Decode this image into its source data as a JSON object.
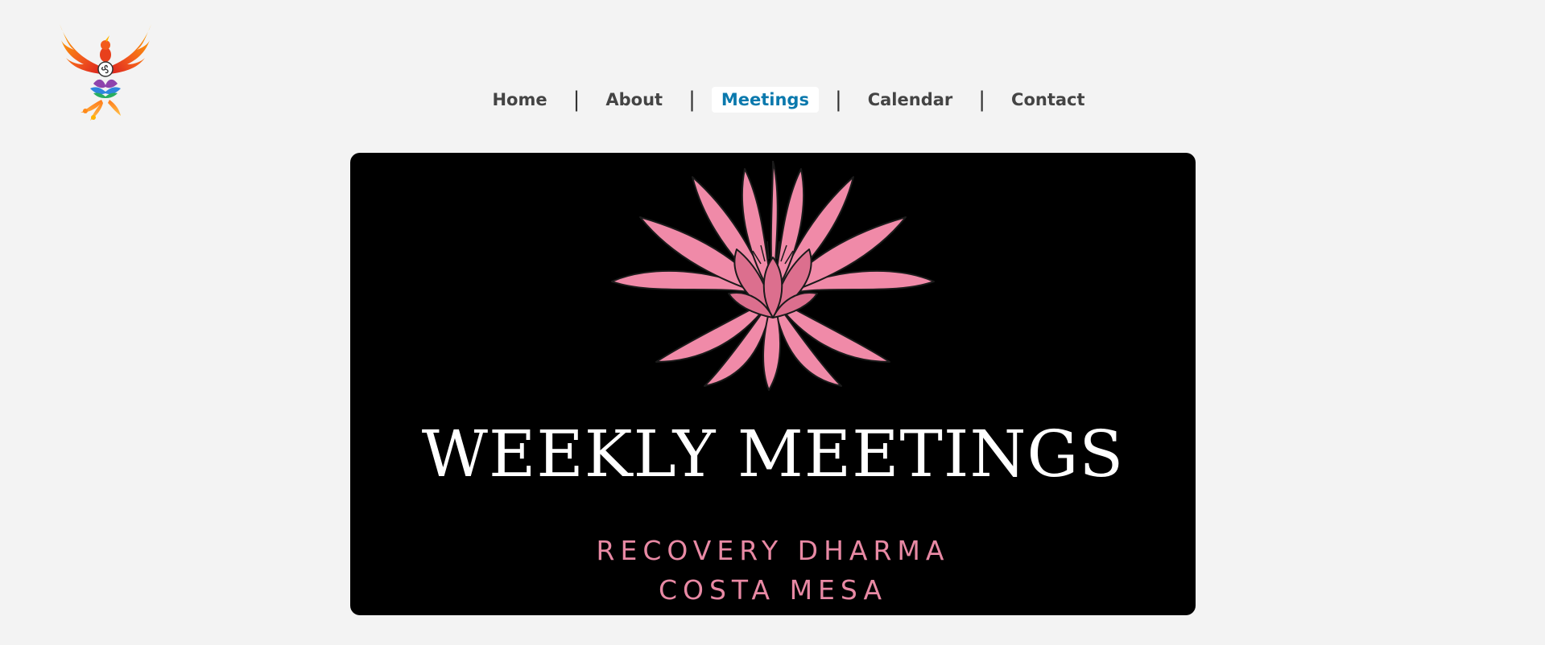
{
  "brand": {
    "logo_icon": "phoenix-lotus-logo"
  },
  "nav": {
    "items": [
      {
        "label": "Home",
        "active": false
      },
      {
        "label": "About",
        "active": false
      },
      {
        "label": "Meetings",
        "active": true
      },
      {
        "label": "Calendar",
        "active": false
      },
      {
        "label": "Contact",
        "active": false
      }
    ],
    "separator": "|",
    "active_color": "#0b79ad",
    "text_color": "#444444"
  },
  "hero": {
    "title": "WEEKLY MEETINGS",
    "subtitle_line1": "RECOVERY DHARMA",
    "subtitle_line2": "COSTA MESA",
    "icon": "lotus-flower-icon",
    "background_color": "#000000",
    "accent_color": "#e889a4"
  }
}
